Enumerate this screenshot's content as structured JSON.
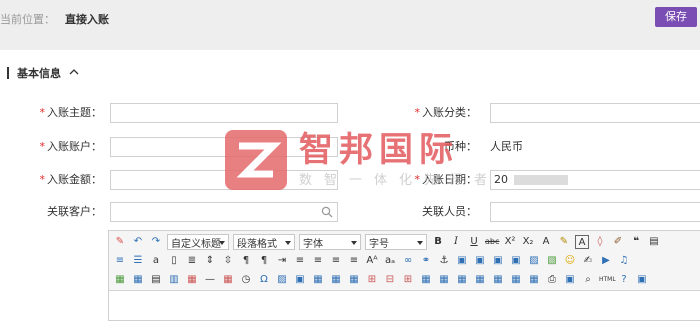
{
  "header": {
    "breadcrumb_prefix": "当前位置：",
    "breadcrumb_current": "直接入账",
    "save_label": "保存"
  },
  "section": {
    "title": "基本信息"
  },
  "form": {
    "subject_label": "入账主题：",
    "category_label": "入账分类：",
    "account_label": "入账账户：",
    "currency_label": "币种：",
    "currency_value": "人民币",
    "amount_label": "入账金额：",
    "date_label": "入账日期：",
    "date_value": "20",
    "customer_label": "关联客户：",
    "person_label": "关联人员："
  },
  "toolbar": {
    "custom_title": "自定义标题",
    "paragraph": "段落格式",
    "font_family": "字体",
    "font_size": "字号"
  },
  "watermark": {
    "brand": "智邦国际",
    "slogan": "数智一体化先行者"
  },
  "colors": {
    "accent": "#7a4db4",
    "required": "#e0292b",
    "watermark": "#e35a5d"
  }
}
